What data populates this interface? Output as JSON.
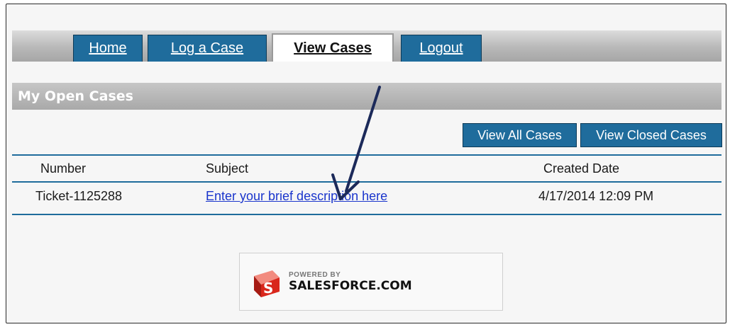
{
  "nav": {
    "tabs": [
      {
        "label": "Home"
      },
      {
        "label": "Log a Case"
      },
      {
        "label": "View Cases",
        "active": true
      },
      {
        "label": "Logout"
      }
    ]
  },
  "section": {
    "title": "My Open Cases"
  },
  "actions": {
    "view_all": "View All Cases",
    "view_closed": "View Closed Cases"
  },
  "table": {
    "headers": [
      "Number",
      "Subject",
      "Created Date"
    ],
    "rows": [
      {
        "number": "Ticket-1125288",
        "subject": "Enter your brief description here",
        "created": "4/17/2014 12:09 PM"
      }
    ]
  },
  "footer": {
    "powered_by": "POWERED BY",
    "brand": "SALESFORCE.COM"
  },
  "colors": {
    "tab_blue": "#1f6c9c",
    "header_gray": "#b5b5b5",
    "link_blue": "#1a35cc",
    "arrow_navy": "#1c2a5a",
    "logo_red": "#d9271c"
  }
}
